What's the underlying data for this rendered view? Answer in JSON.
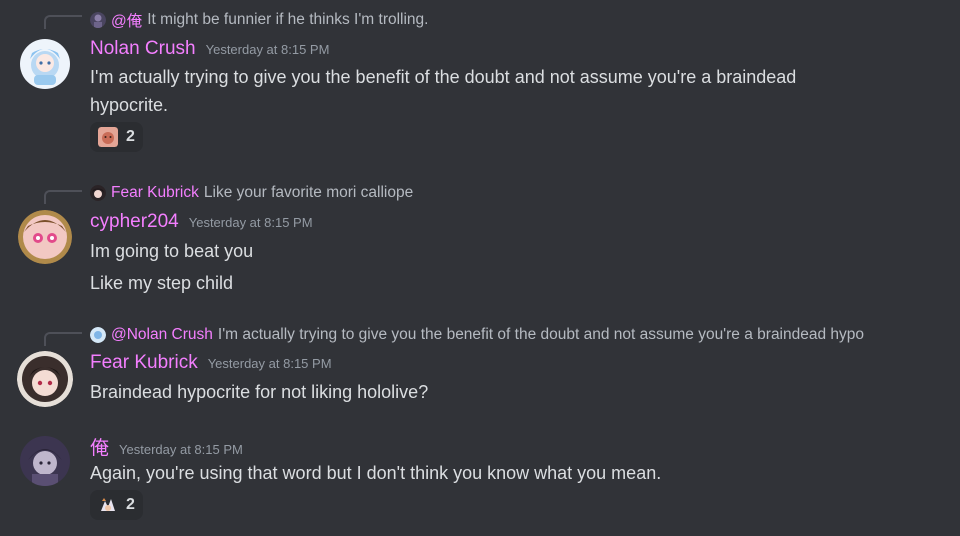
{
  "messages": [
    {
      "reply": {
        "author": "@俺",
        "text": "It might be funnier if he thinks I'm trolling."
      },
      "author": "Nolan Crush",
      "timestamp": "Yesterday at 8:15 PM",
      "lines": [
        "I'm actually trying to give you the benefit of the doubt and not assume you're a braindead",
        "hypocrite."
      ],
      "reaction": {
        "emoji": "emoji-reaction-icon",
        "count": "2"
      }
    },
    {
      "reply": {
        "author": "Fear Kubrick",
        "text": "Like your favorite mori calliope"
      },
      "author": "cypher204",
      "timestamp": "Yesterday at 8:15 PM",
      "lines": [
        "Im going to beat you",
        "Like my step child"
      ]
    },
    {
      "reply": {
        "author": "@Nolan Crush",
        "text": "I'm actually trying to give you the benefit of the doubt and not assume you're a braindead hypo"
      },
      "author": "Fear Kubrick",
      "timestamp": "Yesterday at 8:15 PM",
      "lines": [
        "Braindead hypocrite for not liking hololive?"
      ]
    },
    {
      "author": "俺",
      "timestamp": "Yesterday at 8:15 PM",
      "lines": [
        "Again, you're using that word but I don't think you know what you mean."
      ],
      "reaction": {
        "emoji": "emoji-reaction-icon",
        "count": "2"
      }
    }
  ],
  "colors": {
    "background": "#313338",
    "username": "#f47fff",
    "text": "#dbdee1",
    "muted": "#949ba4",
    "reaction_bg": "#2b2d31"
  }
}
